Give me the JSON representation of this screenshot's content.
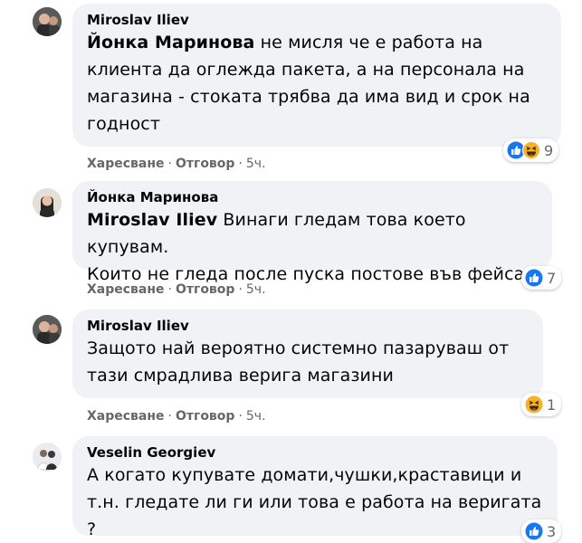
{
  "comments": [
    {
      "author": "Miroslav Iliev",
      "mention": "Йонка Маринова",
      "text_line1": " не мисля че е работа на",
      "text_line2": "клиента да оглежда пакета, а на персонала на",
      "text_line3": "магазина - стоката трябва да има вид и срок на",
      "text_line4": "годност",
      "like": "Харесване",
      "reply": "Отговор",
      "time": "5ч.",
      "reactions": [
        "like-icon",
        "haha-icon"
      ],
      "reaction_count": "9"
    },
    {
      "author": "Йонка Маринова",
      "mention": "Miroslav Iliev",
      "text_line1": " Винаги гледам това което купувам.",
      "text_line2": "Които не гледа после пуска постове във фейса.",
      "like": "Харесване",
      "reply": "Отговор",
      "time": "5ч.",
      "reactions": [
        "like-icon"
      ],
      "reaction_count": "7"
    },
    {
      "author": "Miroslav Iliev",
      "text_line1": "Защото най вероятно системно пазаруваш от",
      "text_line2": "тази смрадлива верига магазини",
      "like": "Харесване",
      "reply": "Отговор",
      "time": "5ч.",
      "reactions": [
        "haha-icon"
      ],
      "reaction_count": "1"
    },
    {
      "author": "Veselin Georgiev",
      "text_line1": "А когато купувате домати,чушки,краставици и",
      "text_line2": "т.н. гледате ли ги или това е работа на веригата ?",
      "reactions": [
        "like-icon"
      ],
      "reaction_count": "3"
    }
  ],
  "separator": "·",
  "colors": {
    "bubble": "#f0f2f5",
    "meta": "#65676b",
    "like": "#1877f2",
    "haha": "#f7b125"
  }
}
